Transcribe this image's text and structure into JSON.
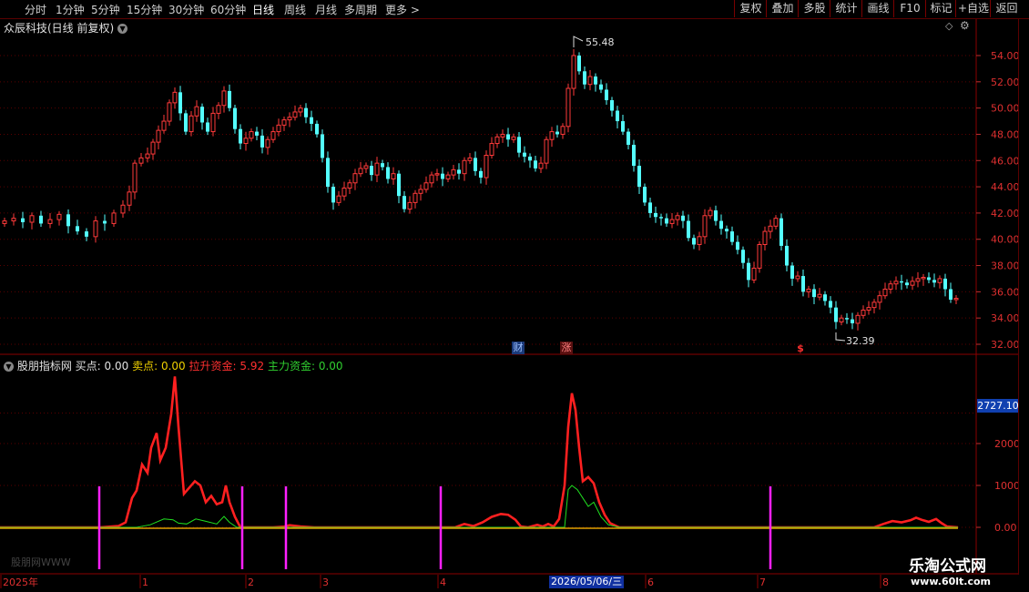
{
  "toolbar": {
    "periods": [
      {
        "label": "分时",
        "active": false
      },
      {
        "label": "1分钟",
        "active": false
      },
      {
        "label": "5分钟",
        "active": false
      },
      {
        "label": "15分钟",
        "active": false
      },
      {
        "label": "30分钟",
        "active": false
      },
      {
        "label": "60分钟",
        "active": false
      },
      {
        "label": "日线",
        "active": true
      },
      {
        "label": "周线",
        "active": false
      },
      {
        "label": "月线",
        "active": false
      },
      {
        "label": "多周期",
        "active": false
      },
      {
        "label": "更多",
        "active": false
      }
    ],
    "actions": [
      "复权",
      "叠加",
      "多股",
      "统计",
      "画线",
      "F10",
      "标记",
      "+自选",
      "返回"
    ]
  },
  "main_chart": {
    "title": "众辰科技(日线 前复权)",
    "y_ticks": [
      "54.00",
      "52.00",
      "50.00",
      "48.00",
      "46.00",
      "44.00",
      "42.00",
      "40.00",
      "38.00",
      "36.00",
      "34.00",
      "32.00"
    ],
    "high_label": "55.48",
    "low_label": "32.39",
    "markers": [
      {
        "label": "财",
        "color": "#3a6fd8"
      },
      {
        "label": "涨",
        "color": "#d03030"
      },
      {
        "label": "$",
        "color": "#e03030"
      }
    ]
  },
  "indicator": {
    "name": "股朋指标网",
    "items": [
      {
        "label": "买点:",
        "value": "0.00",
        "color": "#e0e0e0"
      },
      {
        "label": "卖点:",
        "value": "0.00",
        "color": "#f0d000"
      },
      {
        "label": "拉升资金:",
        "value": "5.92",
        "color": "#ff3030"
      },
      {
        "label": "主力资金:",
        "value": "0.00",
        "color": "#30d030"
      }
    ],
    "y_ticks": [
      "2000",
      "1000",
      "0.00"
    ],
    "current_value": "2727.10",
    "watermark": "股朋网WWW"
  },
  "date_axis": {
    "labels": [
      "2025年",
      "1",
      "2",
      "3",
      "4",
      "6",
      "7",
      "8"
    ],
    "cursor_date": "2026/05/06/三"
  },
  "site_watermark": {
    "name": "乐淘公式网",
    "url": "www.60lt.com"
  },
  "colors": {
    "up": "#ff3a3a",
    "down": "#54ffff",
    "red_line": "#ff2020",
    "green_line": "#20e020",
    "signal": "#ff20ff"
  }
}
